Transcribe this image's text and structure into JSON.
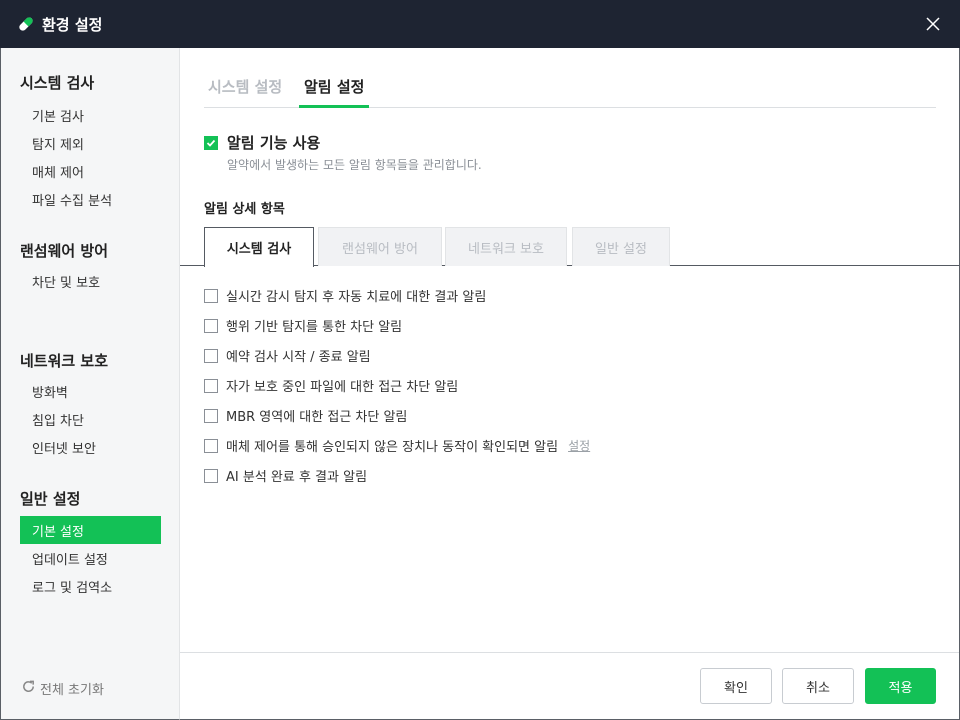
{
  "window": {
    "title": "환경 설정",
    "logo_icon": "pill-icon",
    "close_icon": "close-icon"
  },
  "sidebar": {
    "groups": [
      {
        "title": "시스템 검사",
        "items": [
          "기본 검사",
          "탐지 제외",
          "매체 제어",
          "파일 수집 분석"
        ]
      },
      {
        "title": "랜섬웨어 방어",
        "items": [
          "차단 및 보호"
        ]
      },
      {
        "title": "네트워크 보호",
        "items": [
          "방화벽",
          "침입 차단",
          "인터넷 보안"
        ]
      },
      {
        "title": "일반 설정",
        "items": [
          "기본 설정",
          "업데이트 설정",
          "로그 및 검역소"
        ]
      }
    ],
    "active_item": "기본 설정",
    "reset_label": "전체 초기화"
  },
  "top_tabs": [
    {
      "label": "시스템 설정",
      "active": false
    },
    {
      "label": "알림 설정",
      "active": true
    }
  ],
  "notification": {
    "enable_label": "알림 기능 사용",
    "enabled": true,
    "description": "알약에서 발생하는 모든 알림 항목들을 관리합니다.",
    "detail_title": "알림 상세 항목"
  },
  "sub_tabs": [
    {
      "label": "시스템 검사",
      "active": true
    },
    {
      "label": "랜섬웨어 방어",
      "active": false
    },
    {
      "label": "네트워크 보호",
      "active": false
    },
    {
      "label": "일반 설정",
      "active": false
    }
  ],
  "options": [
    {
      "label": "실시간 감시 탐지 후 자동 치료에 대한 결과 알림",
      "checked": false
    },
    {
      "label": "행위 기반 탐지를 통한 차단 알림",
      "checked": false
    },
    {
      "label": "예약 검사 시작 / 종료 알림",
      "checked": false
    },
    {
      "label": "자가 보호 중인 파일에 대한 접근 차단 알림",
      "checked": false
    },
    {
      "label": "MBR 영역에 대한 접근 차단 알림",
      "checked": false
    },
    {
      "label": "매체 제어를 통해 승인되지 않은 장치나 동작이 확인되면 알림",
      "checked": false,
      "link": "설정"
    },
    {
      "label": "AI 분석 완료 후 결과 알림",
      "checked": false
    }
  ],
  "footer": {
    "confirm_label": "확인",
    "cancel_label": "취소",
    "apply_label": "적용"
  },
  "colors": {
    "accent": "#13c156",
    "titlebar": "#1e2432",
    "sidebar_bg": "#f5f6f7"
  }
}
